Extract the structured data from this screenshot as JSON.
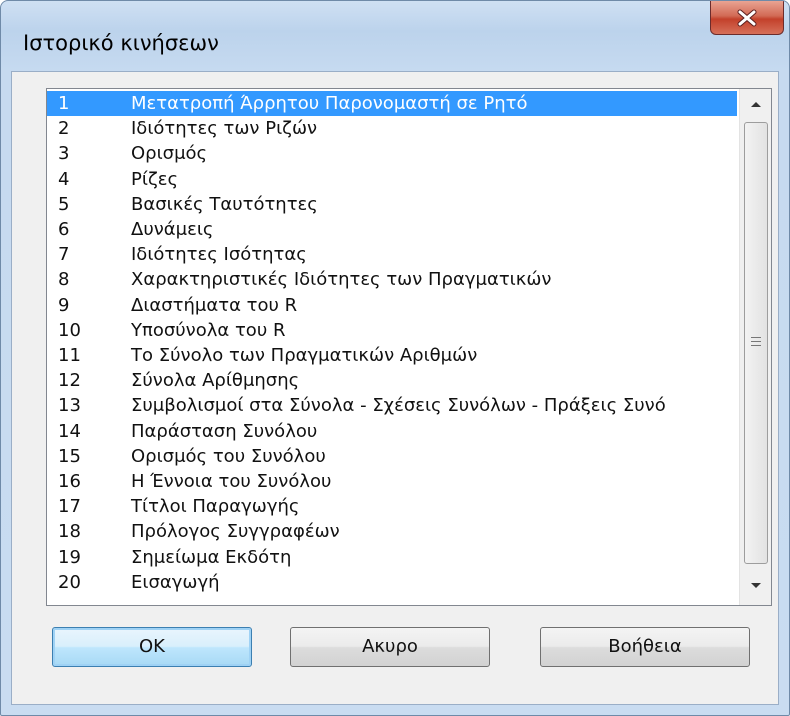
{
  "window": {
    "title": "Ιστορικό κινήσεων"
  },
  "list": {
    "items": [
      {
        "num": "1",
        "label": "Μετατροπή Άρρητου Παρονομαστή σε Ρητό",
        "selected": true
      },
      {
        "num": "2",
        "label": "Ιδιότητες των Ριζών"
      },
      {
        "num": "3",
        "label": "Ορισμός"
      },
      {
        "num": "4",
        "label": "Ρίζες"
      },
      {
        "num": "5",
        "label": "Βασικές Ταυτότητες"
      },
      {
        "num": "6",
        "label": "Δυνάμεις"
      },
      {
        "num": "7",
        "label": "Ιδιότητες Ισότητας"
      },
      {
        "num": "8",
        "label": "Χαρακτηριστικές Ιδιότητες των Πραγματικών"
      },
      {
        "num": "9",
        "label": "Διαστήματα του R"
      },
      {
        "num": "10",
        "label": "Υποσύνολα του R"
      },
      {
        "num": "11",
        "label": "Το Σύνολο των Πραγματικών Αριθμών"
      },
      {
        "num": "12",
        "label": "Σύνολα Αρίθμησης"
      },
      {
        "num": "13",
        "label": "Συμβολισμοί στα Σύνολα - Σχέσεις Συνόλων - Πράξεις Συνό"
      },
      {
        "num": "14",
        "label": "Παράσταση Συνόλου"
      },
      {
        "num": "15",
        "label": "Ορισμός του Συνόλου"
      },
      {
        "num": "16",
        "label": "Η Έννοια του Συνόλου"
      },
      {
        "num": "17",
        "label": " Τίτλοι Παραγωγής"
      },
      {
        "num": "18",
        "label": "Πρόλογος Συγγραφέων"
      },
      {
        "num": "19",
        "label": "Σημείωμα Εκδότη"
      },
      {
        "num": "20",
        "label": "Εισαγωγή"
      }
    ]
  },
  "buttons": {
    "ok": "OK",
    "cancel": "Ακυρο",
    "help": "Βοήθεια"
  },
  "icons": {
    "close": "close-icon",
    "scroll_up": "scroll-up-arrow-icon",
    "scroll_down": "scroll-down-arrow-icon"
  },
  "colors": {
    "selection": "#3399ff",
    "close_button": "#c3412b"
  }
}
